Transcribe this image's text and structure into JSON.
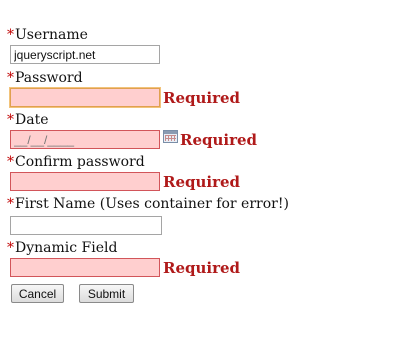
{
  "required_marker": "*",
  "form": {
    "username": {
      "label": "Username",
      "value": "jqueryscript.net"
    },
    "password": {
      "label": "Password",
      "value": "",
      "error": "Required"
    },
    "date": {
      "label": "Date",
      "placeholder": "__/__/____",
      "error": "Required",
      "calendar_icon": "calendar-icon"
    },
    "confirm_password": {
      "label": "Confirm password",
      "value": "",
      "error": "Required"
    },
    "first_name": {
      "label": "First Name (Uses container for error!)",
      "value": ""
    },
    "dynamic_field": {
      "label": "Dynamic Field",
      "value": "",
      "error": "Required"
    }
  },
  "buttons": {
    "cancel": "Cancel",
    "submit": "Submit"
  },
  "colors": {
    "required_star": "#c00000",
    "error_text": "#b01a1a",
    "error_field_bg": "#ffcfcf",
    "error_field_border": "#d2555a",
    "focus_border": "#e0a050"
  }
}
